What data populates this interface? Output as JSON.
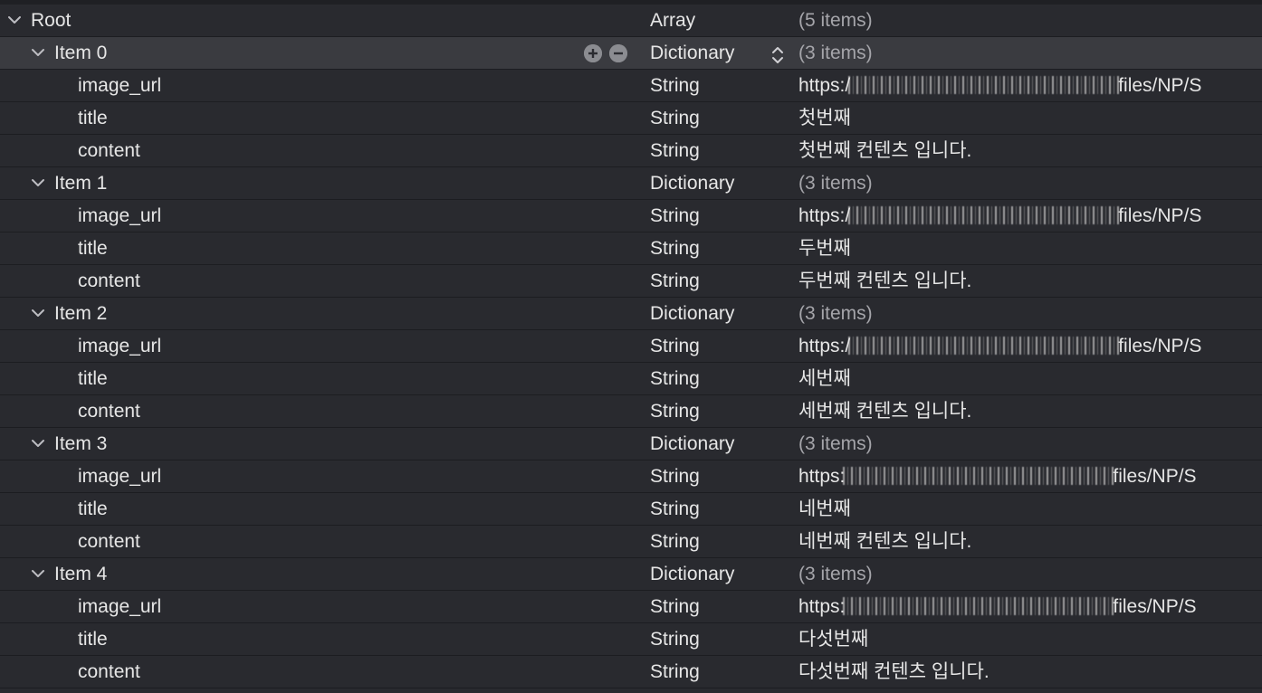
{
  "root": {
    "key": "Root",
    "type": "Array",
    "value": "(5 items)"
  },
  "items": [
    {
      "key": "Item 0",
      "type": "Dictionary",
      "value": "(3 items)",
      "selected": true,
      "children": [
        {
          "key": "image_url",
          "type": "String",
          "value_prefix": "https:/",
          "value_suffix": "files/NP/S"
        },
        {
          "key": "title",
          "type": "String",
          "value": "첫번째"
        },
        {
          "key": "content",
          "type": "String",
          "value": "첫번째 컨텐츠 입니다."
        }
      ]
    },
    {
      "key": "Item 1",
      "type": "Dictionary",
      "value": "(3 items)",
      "selected": false,
      "children": [
        {
          "key": "image_url",
          "type": "String",
          "value_prefix": "https:/",
          "value_suffix": "files/NP/S"
        },
        {
          "key": "title",
          "type": "String",
          "value": "두번째"
        },
        {
          "key": "content",
          "type": "String",
          "value": "두번째 컨텐츠 입니다."
        }
      ]
    },
    {
      "key": "Item 2",
      "type": "Dictionary",
      "value": "(3 items)",
      "selected": false,
      "children": [
        {
          "key": "image_url",
          "type": "String",
          "value_prefix": "https:/",
          "value_suffix": "files/NP/S"
        },
        {
          "key": "title",
          "type": "String",
          "value": "세번째"
        },
        {
          "key": "content",
          "type": "String",
          "value": "세번째 컨텐츠 입니다."
        }
      ]
    },
    {
      "key": "Item 3",
      "type": "Dictionary",
      "value": "(3 items)",
      "selected": false,
      "children": [
        {
          "key": "image_url",
          "type": "String",
          "value_prefix": "https:",
          "value_suffix": "files/NP/S"
        },
        {
          "key": "title",
          "type": "String",
          "value": "네번째"
        },
        {
          "key": "content",
          "type": "String",
          "value": "네번째 컨텐츠 입니다."
        }
      ]
    },
    {
      "key": "Item 4",
      "type": "Dictionary",
      "value": "(3 items)",
      "selected": false,
      "children": [
        {
          "key": "image_url",
          "type": "String",
          "value_prefix": "https:",
          "value_suffix": "files/NP/S"
        },
        {
          "key": "title",
          "type": "String",
          "value": "다섯번째"
        },
        {
          "key": "content",
          "type": "String",
          "value": "다섯번째 컨텐츠 입니다."
        }
      ]
    }
  ],
  "icons": {
    "disclosure": "chevron-down-icon",
    "add": "plus-circle-icon",
    "remove": "minus-circle-icon",
    "stepper": "up-down-stepper-icon"
  },
  "colors": {
    "background": "#292a2f",
    "selected_row": "#3a3b40",
    "text": "#e6e6e6",
    "muted_text": "#a5a5aa"
  }
}
